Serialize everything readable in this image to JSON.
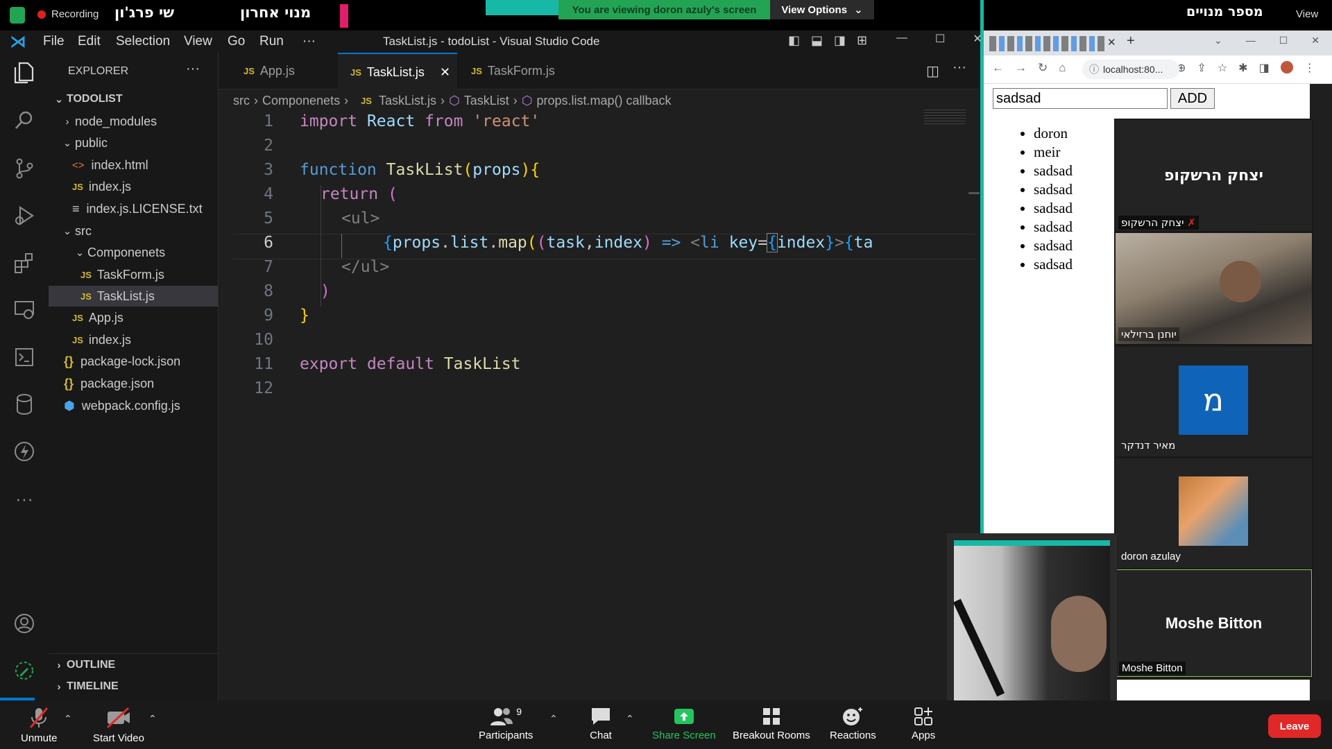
{
  "zoom": {
    "recording_label": "Recording",
    "meeting_name_1": "שי פרג'ון",
    "meeting_name_2": "מנוי אחרון",
    "viewing_banner": "You are viewing doron azuly's screen",
    "view_options": "View Options",
    "view_label": "View",
    "top_right_text": "מספר מנויים",
    "bottom": {
      "unmute": "Unmute",
      "start_video": "Start Video",
      "participants": "Participants",
      "participants_count": "9",
      "chat": "Chat",
      "share_screen": "Share Screen",
      "breakout_rooms": "Breakout Rooms",
      "reactions": "Reactions",
      "apps": "Apps",
      "leave": "Leave"
    },
    "participants": [
      {
        "name": "יצחק הרשקופ",
        "big_label": "יצחק הרשקופ"
      },
      {
        "name": "יוחנן ברזילאי"
      },
      {
        "name": "מאיר דנדקר",
        "initial": "מ"
      },
      {
        "name": "doron azulay"
      },
      {
        "name": "Moshe Bitton",
        "big_label": "Moshe Bitton"
      }
    ],
    "colors": {
      "leave": "#e02828",
      "share": "#23c55e",
      "banner": "#23a455"
    }
  },
  "vscode": {
    "menu": [
      "File",
      "Edit",
      "Selection",
      "View",
      "Go",
      "Run",
      "···"
    ],
    "window_title": "TaskList.js - todoList - Visual Studio Code",
    "explorer_title": "EXPLORER",
    "project": "TODOLIST",
    "tree": {
      "node_modules": "node_modules",
      "public": "public",
      "index_html": "index.html",
      "index_js_pub": "index.js",
      "license": "index.js.LICENSE.txt",
      "src": "src",
      "componenets": "Componenets",
      "taskform": "TaskForm.js",
      "tasklist": "TaskList.js",
      "app": "App.js",
      "index_js_src": "index.js",
      "package_lock": "package-lock.json",
      "package": "package.json",
      "webpack": "webpack.config.js"
    },
    "outline": "OUTLINE",
    "timeline": "TIMELINE",
    "tabs": [
      "App.js",
      "TaskList.js",
      "TaskForm.js"
    ],
    "breadcrumb": [
      "src",
      "Componenets",
      "TaskList.js",
      "TaskList",
      "props.list.map() callback"
    ],
    "line_numbers": [
      "1",
      "2",
      "3",
      "4",
      "5",
      "6",
      "7",
      "8",
      "9",
      "10",
      "11",
      "12"
    ],
    "code": {
      "l1_import": "import",
      "l1_react": "React",
      "l1_from": "from",
      "l1_str": "'react'",
      "l3_function": "function",
      "l3_name": "TaskList",
      "l3_props": "props",
      "l4_return": "return",
      "l5_ul": "<ul>",
      "l6_props": "props",
      "l6_list": "list",
      "l6_map": "map",
      "l6_task": "task",
      "l6_index": "index",
      "l6_arrow": "=>",
      "l6_li": "li",
      "l6_key": "key",
      "l6_index2": "index",
      "l6_ta": "ta",
      "l7_ul": "</ul>",
      "l11_export": "export",
      "l11_default": "default",
      "l11_name": "TaskList"
    }
  },
  "browser": {
    "url": "localhost:80...",
    "input_value": "sadsad",
    "add_button": "ADD",
    "items": [
      "doron",
      "meir",
      "sadsad",
      "sadsad",
      "sadsad",
      "sadsad",
      "sadsad",
      "sadsad"
    ]
  }
}
